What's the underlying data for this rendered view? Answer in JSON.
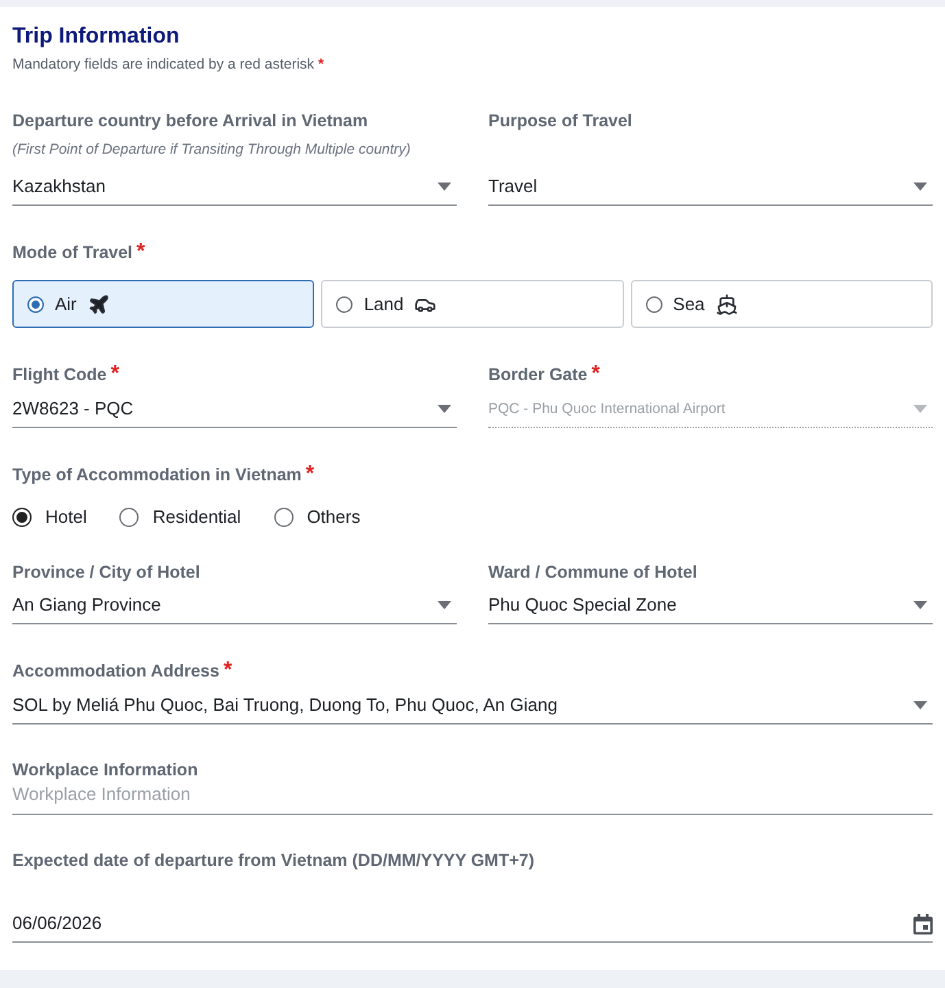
{
  "section": {
    "title": "Trip Information",
    "note": "Mandatory fields are indicated by a red asterisk",
    "note_mark": "*"
  },
  "rows": [
    {
      "fields": [
        {
          "kind": "select",
          "label": "Departure country before Arrival in Vietnam",
          "hint": "(First Point of Departure if Transiting Through Multiple country)",
          "value": "Kazakhstan",
          "disabled": false
        },
        {
          "kind": "select",
          "label": "Purpose of Travel",
          "value": "Travel",
          "disabled": false
        }
      ]
    },
    {
      "fields": [
        {
          "kind": "mode",
          "label": "Mode of Travel",
          "required_mark": "*",
          "options": [
            {
              "kind": "air",
              "label": "Air",
              "selected": true
            },
            {
              "kind": "land",
              "label": "Land",
              "selected": false
            },
            {
              "kind": "sea",
              "label": "Sea",
              "selected": false
            }
          ]
        }
      ]
    },
    {
      "fields": [
        {
          "kind": "select",
          "label": "Flight Code",
          "required_mark": "*",
          "value": "2W8623 - PQC",
          "disabled": false
        },
        {
          "kind": "select",
          "label": "Border Gate",
          "required_mark": "*",
          "value": "PQC -  Phu Quoc International Airport",
          "disabled": true
        }
      ]
    },
    {
      "fields": [
        {
          "kind": "radio",
          "label": "Type of Accommodation in Vietnam",
          "required_mark": "*",
          "options": [
            {
              "label": "Hotel",
              "selected": true
            },
            {
              "label": "Residential",
              "selected": false
            },
            {
              "label": "Others",
              "selected": false
            }
          ]
        }
      ]
    },
    {
      "fields": [
        {
          "kind": "select",
          "label": "Province / City of Hotel",
          "value": "An Giang Province",
          "disabled": false
        },
        {
          "kind": "select",
          "label": "Ward / Commune of Hotel",
          "value": "Phu Quoc Special Zone",
          "disabled": false
        }
      ]
    },
    {
      "fields": [
        {
          "kind": "select",
          "label": "Accommodation Address",
          "required_mark": "*",
          "value": "SOL by Meliá Phu Quoc, Bai Truong, Duong To, Phu Quoc, An Giang",
          "disabled": false
        }
      ]
    },
    {
      "fields": [
        {
          "kind": "text",
          "label": "Workplace Information",
          "placeholder": "Workplace Information"
        }
      ]
    },
    {
      "fields": [
        {
          "kind": "date",
          "label": "Expected date of departure from Vietnam (DD/MM/YYYY GMT+7)",
          "value": "06/06/2026"
        }
      ]
    }
  ]
}
